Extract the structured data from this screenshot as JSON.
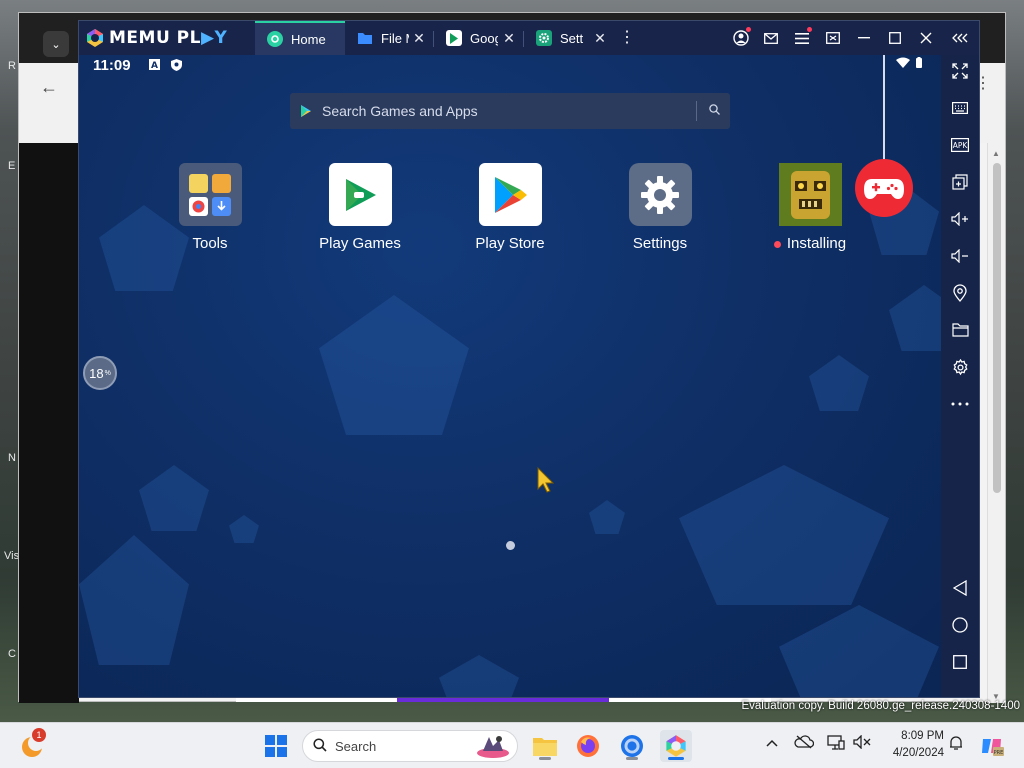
{
  "desktop": {
    "edge_labels": [
      "R",
      "E",
      "N",
      "Vis",
      "C"
    ]
  },
  "emulator": {
    "brand": {
      "word_a": "MEMU PL",
      "word_b": "▶Y"
    },
    "tabs": [
      {
        "label": "Home",
        "icon": "memu-home-icon",
        "active": true
      },
      {
        "label": "File M",
        "icon": "folder-icon"
      },
      {
        "label": "Goog",
        "icon": "google-play-icon"
      },
      {
        "label": "Sett",
        "icon": "settings-icon"
      }
    ],
    "status_bar": {
      "time": "11:09"
    },
    "search": {
      "placeholder": "Search Games and Apps"
    },
    "apps": [
      {
        "label": "Tools"
      },
      {
        "label": "Play Games"
      },
      {
        "label": "Play Store"
      },
      {
        "label": "Settings"
      },
      {
        "label": "Installing"
      }
    ],
    "progress": {
      "value": "18",
      "unit": "%"
    }
  },
  "overlay": {
    "evaluation_text": "Evaluation copy. Build 26080.ge_release.240308-1400"
  },
  "taskbar": {
    "search_placeholder": "Search",
    "notification_count": "1",
    "clock_time": "8:09 PM",
    "clock_date": "4/20/2024"
  },
  "colors": {
    "accent_tab": "#2ad1a3",
    "gamepad": "#ee2b35",
    "screen_bg": "#0f2f66"
  }
}
